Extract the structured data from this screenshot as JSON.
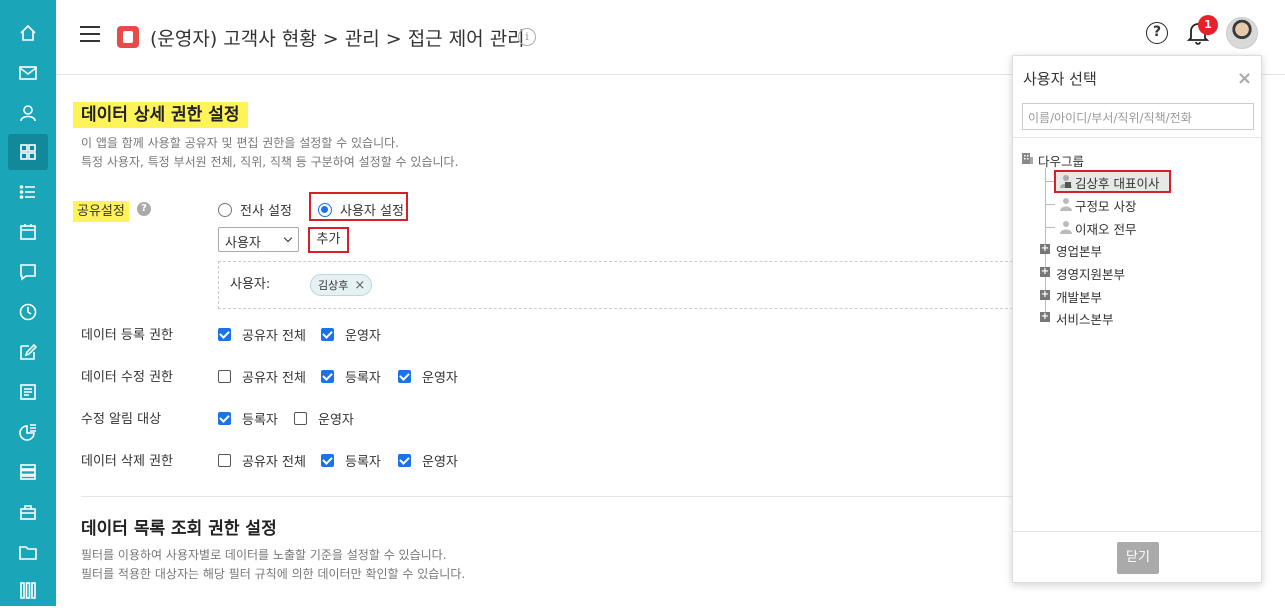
{
  "header": {
    "title": "(운영자) 고객사 현황 > 관리 > 접근 제어 관리",
    "help_symbol": "?",
    "info_symbol": "i",
    "notification_count": "1"
  },
  "sidebar": {
    "items": [
      "home-icon",
      "mail-icon",
      "contacts-icon",
      "apps-icon",
      "list-icon",
      "calendar-icon",
      "chat-icon",
      "clock-icon",
      "edit-icon",
      "board-icon",
      "chart-icon",
      "stack-icon",
      "briefcase-icon",
      "folder-icon",
      "more-apps-icon"
    ],
    "active_index": 3
  },
  "detail_section": {
    "title": "데이터 상세 권한 설정",
    "desc_line1": "이 앱을 함께 사용할 공유자 및 편집 권한을 설정할 수 있습니다.",
    "desc_line2": "특정 사용자, 특정 부서원 전체, 직위, 직책 등 구분하여 설정할 수 있습니다.",
    "share_label": "공유설정",
    "share_options": [
      "전사 설정",
      "사용자 설정"
    ],
    "share_selected": "사용자 설정",
    "select_value": "사용자",
    "add_button": "추가",
    "users_label": "사용자:",
    "users": [
      "김상후"
    ]
  },
  "permissions": [
    {
      "label": "데이터 등록 권한",
      "options": [
        {
          "text": "공유자 전체",
          "checked": true
        },
        {
          "text": "운영자",
          "checked": true
        }
      ]
    },
    {
      "label": "데이터 수정 권한",
      "options": [
        {
          "text": "공유자 전체",
          "checked": false
        },
        {
          "text": "등록자",
          "checked": true
        },
        {
          "text": "운영자",
          "checked": true
        }
      ]
    },
    {
      "label": "수정 알림 대상",
      "options": [
        {
          "text": "등록자",
          "checked": true
        },
        {
          "text": "운영자",
          "checked": false
        }
      ]
    },
    {
      "label": "데이터 삭제 권한",
      "options": [
        {
          "text": "공유자 전체",
          "checked": false
        },
        {
          "text": "등록자",
          "checked": true
        },
        {
          "text": "운영자",
          "checked": true
        }
      ]
    }
  ],
  "list_section": {
    "title": "데이터 목록 조회 권한 설정",
    "desc_line1": "필터를 이용하여 사용자별로 데이터를 노출할 기준을 설정할 수 있습니다.",
    "desc_line2": "필터를 적용한 대상자는 해당 필터 규칙에 의한 데이터만 확인할 수 있습니다."
  },
  "user_picker": {
    "title": "사용자 선택",
    "close_symbol": "×",
    "search_placeholder": "이름/아이디/부서/직위/직책/전화",
    "root": "다우그룹",
    "members": [
      "김상후 대표이사",
      "구정모 사장",
      "이재오 전무"
    ],
    "departments": [
      "영업본부",
      "경영지원본부",
      "개발본부",
      "서비스본부"
    ],
    "close_button": "닫기"
  },
  "colors": {
    "sidebar": "#1aa5b8",
    "highlight": "#fff35a",
    "accent": "#1a73e8",
    "annotation_red": "#d61f2b"
  }
}
